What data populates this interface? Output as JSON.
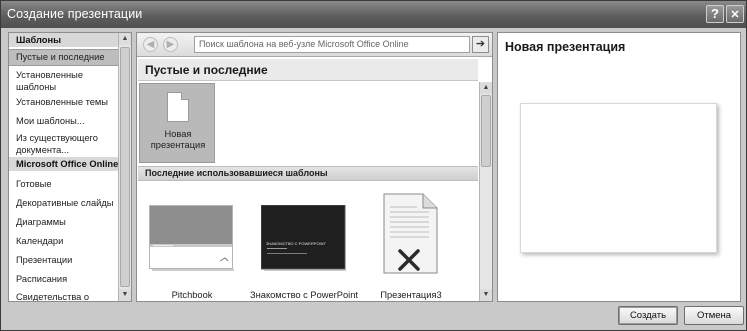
{
  "window": {
    "title": "Создание презентации",
    "help_label": "?",
    "close_label": "✕"
  },
  "sidebar": {
    "section_templates": "Шаблоны",
    "items": [
      {
        "label": "Пустые и последние"
      },
      {
        "label": "Установленные шаблоны"
      },
      {
        "label": "Установленные темы"
      },
      {
        "label": "Мои шаблоны..."
      },
      {
        "label": "Из существующего документа..."
      }
    ],
    "section_online": "Microsoft Office Online",
    "online_items": [
      {
        "label": "Готовые"
      },
      {
        "label": "Декоративные слайды"
      },
      {
        "label": "Диаграммы"
      },
      {
        "label": "Календари"
      },
      {
        "label": "Презентации"
      },
      {
        "label": "Расписания"
      },
      {
        "label": "Свидетельства о"
      }
    ]
  },
  "toolbar": {
    "back_icon": "arrow-left-icon",
    "forward_icon": "arrow-right-icon",
    "search_placeholder": "Поиск шаблона на веб-узле Microsoft Office Online",
    "search_go_icon": "arrow-go-icon"
  },
  "main": {
    "section_title": "Пустые и последние",
    "blank_label": "Новая презентация",
    "recent_header": "Последние использовавшиеся шаблоны",
    "recent": [
      {
        "label": "Pitchbook"
      },
      {
        "label": "Знакомство с PowerPoint",
        "slide_text": "ЗНАКОМСТВО С POWERPOINT"
      },
      {
        "label": "Презентация3"
      }
    ]
  },
  "preview": {
    "title": "Новая презентация"
  },
  "buttons": {
    "create": "Создать",
    "cancel": "Отмена"
  },
  "colors": {
    "titlebar": "#5e5e5e",
    "dialog_bg": "#c9c9c9",
    "selected": "#bdbdbd"
  }
}
